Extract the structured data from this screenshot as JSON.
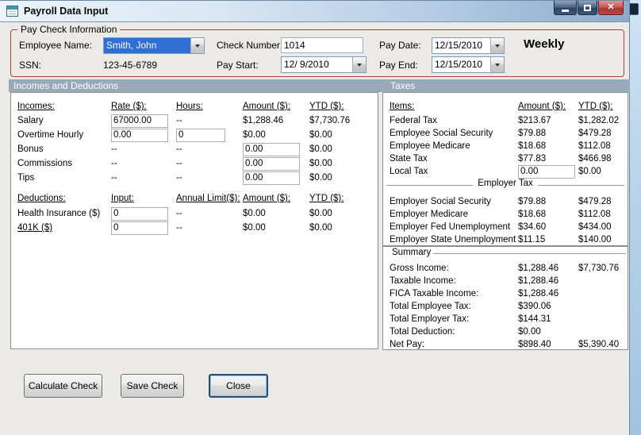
{
  "window": {
    "title": "Payroll Data Input"
  },
  "paycheck": {
    "group_label": "Pay Check Information",
    "employee_name_label": "Employee Name:",
    "employee_name_value": "Smith, John",
    "ssn_label": "SSN:",
    "ssn_value": "123-45-6789",
    "check_number_label": "Check Number:",
    "check_number_value": "1014",
    "pay_start_label": "Pay Start:",
    "pay_start_value": "12/ 9/2010",
    "pay_date_label": "Pay Date:",
    "pay_date_value": "12/15/2010",
    "pay_end_label": "Pay End:",
    "pay_end_value": "12/15/2010",
    "frequency": "Weekly"
  },
  "section_headers": {
    "incomes": "Incomes and Deductions",
    "taxes": "Taxes"
  },
  "incomes": {
    "headers": {
      "name": "Incomes:",
      "rate": "Rate ($):",
      "hours": "Hours:",
      "amount": "Amount ($):",
      "ytd": "YTD ($):"
    },
    "rows": [
      {
        "label": "Salary",
        "rate": "67000.00",
        "hours": "--",
        "amount": "$1,288.46",
        "ytd": "$7,730.76"
      },
      {
        "label": "Overtime Hourly",
        "rate": "0.00",
        "hours": "0",
        "amount": "$0.00",
        "ytd": "$0.00"
      },
      {
        "label": "Bonus",
        "rate": "--",
        "hours": "--",
        "amount": "0.00",
        "ytd": "$0.00"
      },
      {
        "label": "Commissions",
        "rate": "--",
        "hours": "--",
        "amount": "0.00",
        "ytd": "$0.00"
      },
      {
        "label": "Tips",
        "rate": "--",
        "hours": "--",
        "amount": "0.00",
        "ytd": "$0.00"
      }
    ]
  },
  "deductions": {
    "headers": {
      "name": "Deductions:",
      "input": "Input:",
      "limit": "Annual Limit($):",
      "amount": "Amount ($):",
      "ytd": "YTD ($):"
    },
    "rows": [
      {
        "label": "Health Insurance  ($)",
        "input": "0",
        "limit": "--",
        "amount": "$0.00",
        "ytd": "$0.00"
      },
      {
        "label": "401K  ($)",
        "input": "0",
        "limit": "--",
        "amount": "$0.00",
        "ytd": "$0.00"
      }
    ]
  },
  "taxes": {
    "headers": {
      "name": "Items:",
      "amount": "Amount ($):",
      "ytd": "YTD ($):"
    },
    "employee_rows": [
      {
        "label": "Federal Tax",
        "amount": "$213.67",
        "ytd": "$1,282.02"
      },
      {
        "label": "Employee Social Security",
        "amount": "$79.88",
        "ytd": "$479.28"
      },
      {
        "label": "Employee Medicare",
        "amount": "$18.68",
        "ytd": "$112.08"
      },
      {
        "label": "State Tax",
        "amount": "$77.83",
        "ytd": "$466.98"
      }
    ],
    "local_tax": {
      "label": "Local Tax",
      "amount": "0.00",
      "ytd": "$0.00"
    },
    "employer_header": "Employer Tax",
    "employer_rows": [
      {
        "label": "Employer Social Security",
        "amount": "$79.88",
        "ytd": "$479.28"
      },
      {
        "label": "Employer Medicare",
        "amount": "$18.68",
        "ytd": "$112.08"
      },
      {
        "label": "Employer Fed Unemployment",
        "amount": "$34.60",
        "ytd": "$434.00"
      },
      {
        "label": "Employer State Unemployment",
        "amount": "$11.15",
        "ytd": "$140.00"
      }
    ]
  },
  "summary": {
    "group_label": "Summary",
    "rows": [
      {
        "label": "Gross Income:",
        "amount": "$1,288.46",
        "ytd": "$7,730.76"
      },
      {
        "label": "Taxable Income:",
        "amount": "$1,288.46",
        "ytd": ""
      },
      {
        "label": "FICA Taxable Income:",
        "amount": "$1,288.46",
        "ytd": ""
      },
      {
        "label": "Total Employee Tax:",
        "amount": "$390.06",
        "ytd": ""
      },
      {
        "label": "Total Employer Tax:",
        "amount": "$144.31",
        "ytd": ""
      },
      {
        "label": "Total Deduction:",
        "amount": "$0.00",
        "ytd": ""
      },
      {
        "label": "Net Pay:",
        "amount": "$898.40",
        "ytd": "$5,390.40"
      }
    ]
  },
  "buttons": {
    "calculate": "Calculate Check",
    "save": "Save Check",
    "close": "Close"
  },
  "colors": {
    "group_border": "#A6453B",
    "section_header_bg": "#9AA9BA",
    "combo_highlight": "#2F6FD6"
  }
}
